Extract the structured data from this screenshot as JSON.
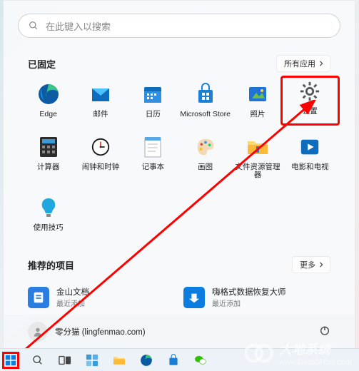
{
  "search": {
    "placeholder": "在此键入以搜索"
  },
  "pinned": {
    "title": "已固定",
    "all_apps": "所有应用",
    "apps": [
      {
        "name": "Edge",
        "icon": "edge"
      },
      {
        "name": "邮件",
        "icon": "mail"
      },
      {
        "name": "日历",
        "icon": "calendar"
      },
      {
        "name": "Microsoft Store",
        "icon": "store"
      },
      {
        "name": "照片",
        "icon": "photos"
      },
      {
        "name": "设置",
        "icon": "settings",
        "highlighted": true
      },
      {
        "name": "计算器",
        "icon": "calculator"
      },
      {
        "name": "闹钟和时钟",
        "icon": "clock"
      },
      {
        "name": "记事本",
        "icon": "notepad"
      },
      {
        "name": "画图",
        "icon": "paint"
      },
      {
        "name": "文件资源管理器",
        "icon": "explorer"
      },
      {
        "name": "电影和电视",
        "icon": "movies"
      },
      {
        "name": "使用技巧",
        "icon": "tips"
      }
    ]
  },
  "recommended": {
    "title": "推荐的项目",
    "more": "更多",
    "items": [
      {
        "title": "金山文档",
        "subtitle": "最近添加",
        "color": "#2a7de1"
      },
      {
        "title": "嗨格式数据恢复大师",
        "subtitle": "最近添加",
        "color": "#0b7de0"
      }
    ]
  },
  "user": {
    "name": "零分猫",
    "domain": "lingfenmao.com"
  },
  "watermark": {
    "brand": "大地系统",
    "url": "www.DadiGhost.com"
  },
  "taskbar_icons": [
    "start",
    "search",
    "taskview",
    "widgets",
    "explorer",
    "edge",
    "store",
    "wechat"
  ]
}
